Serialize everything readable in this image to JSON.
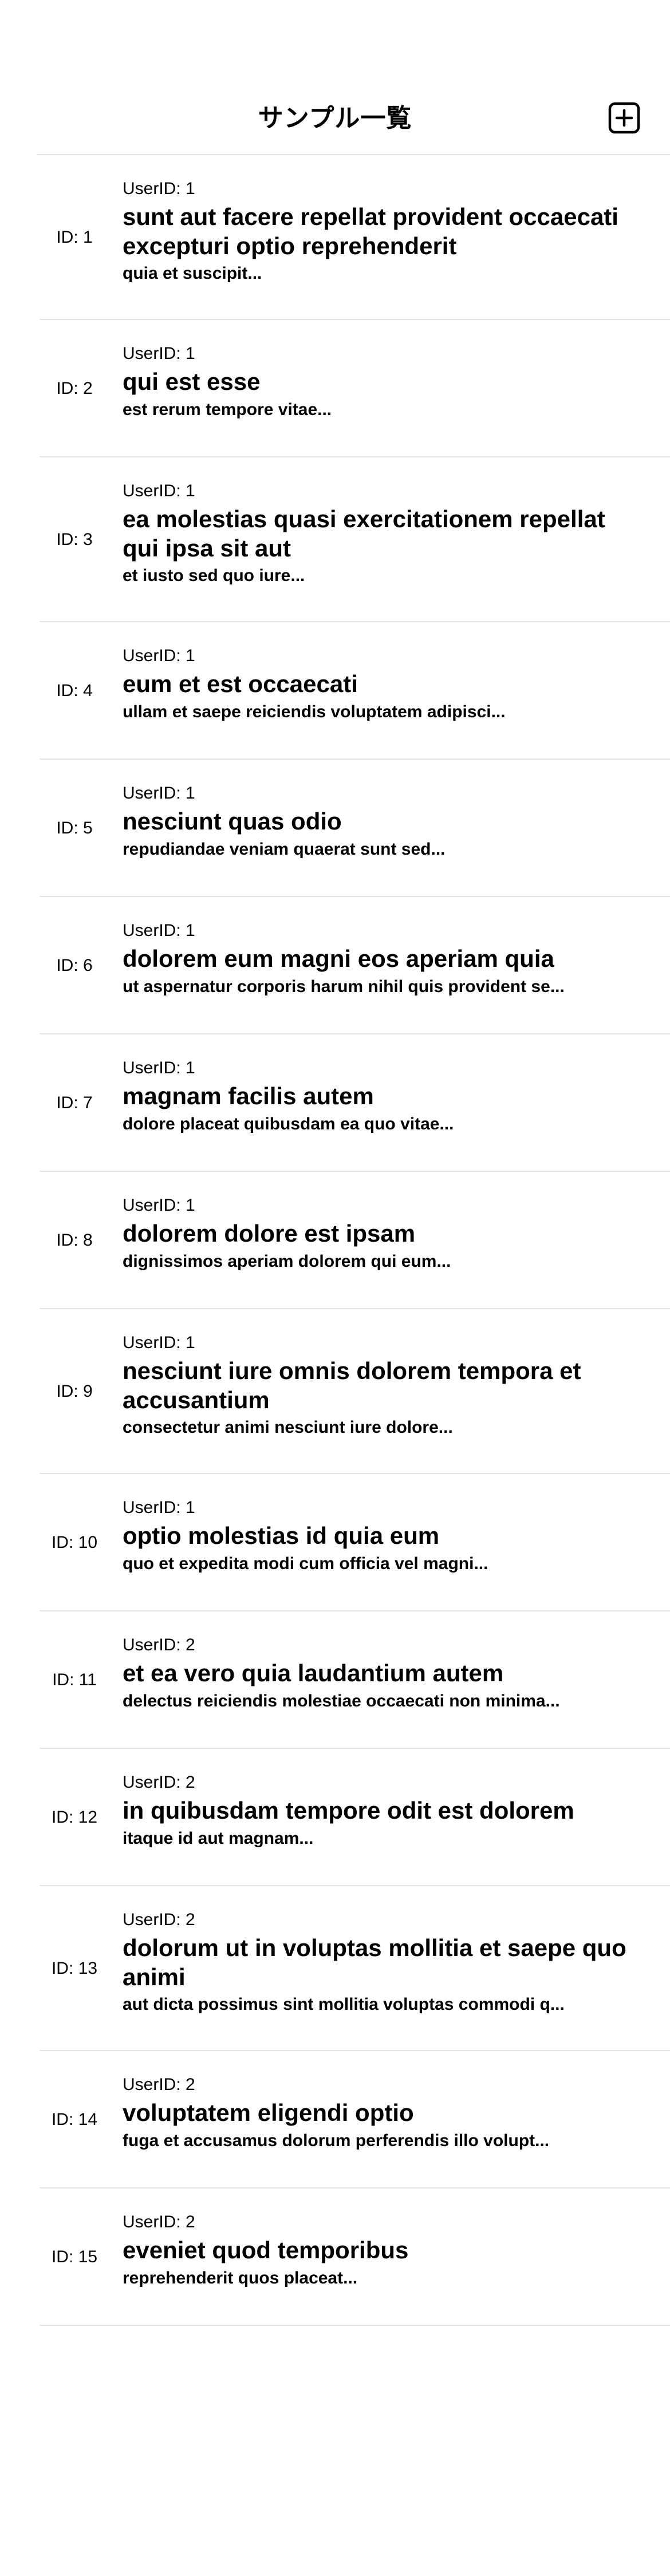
{
  "header": {
    "title": "サンプル一覧",
    "add_icon": "plus-square-icon"
  },
  "posts": [
    {
      "id_label": "ID: 1",
      "user_label": "UserID: 1",
      "title": "sunt aut facere repellat provident occaecati excepturi optio reprehenderit",
      "body": "quia et suscipit..."
    },
    {
      "id_label": "ID: 2",
      "user_label": "UserID: 1",
      "title": "qui est esse",
      "body": "est rerum tempore vitae..."
    },
    {
      "id_label": "ID: 3",
      "user_label": "UserID: 1",
      "title": "ea molestias quasi exercitationem repellat qui ipsa sit aut",
      "body": "et iusto sed quo iure..."
    },
    {
      "id_label": "ID: 4",
      "user_label": "UserID: 1",
      "title": "eum et est occaecati",
      "body": "ullam et saepe reiciendis voluptatem adipisci..."
    },
    {
      "id_label": "ID: 5",
      "user_label": "UserID: 1",
      "title": "nesciunt quas odio",
      "body": "repudiandae veniam quaerat sunt sed..."
    },
    {
      "id_label": "ID: 6",
      "user_label": "UserID: 1",
      "title": "dolorem eum magni eos aperiam quia",
      "body": "ut aspernatur corporis harum nihil quis provident se..."
    },
    {
      "id_label": "ID: 7",
      "user_label": "UserID: 1",
      "title": "magnam facilis autem",
      "body": "dolore placeat quibusdam ea quo vitae..."
    },
    {
      "id_label": "ID: 8",
      "user_label": "UserID: 1",
      "title": "dolorem dolore est ipsam",
      "body": "dignissimos aperiam dolorem qui eum..."
    },
    {
      "id_label": "ID: 9",
      "user_label": "UserID: 1",
      "title": "nesciunt iure omnis dolorem tempora et accusantium",
      "body": "consectetur animi nesciunt iure dolore..."
    },
    {
      "id_label": "ID: 10",
      "user_label": "UserID: 1",
      "title": "optio molestias id quia eum",
      "body": "quo et expedita modi cum officia vel magni..."
    },
    {
      "id_label": "ID: 11",
      "user_label": "UserID: 2",
      "title": "et ea vero quia laudantium autem",
      "body": "delectus reiciendis molestiae occaecati non minima..."
    },
    {
      "id_label": "ID: 12",
      "user_label": "UserID: 2",
      "title": "in quibusdam tempore odit est dolorem",
      "body": "itaque id aut magnam..."
    },
    {
      "id_label": "ID: 13",
      "user_label": "UserID: 2",
      "title": "dolorum ut in voluptas mollitia et saepe quo animi",
      "body": "aut dicta possimus sint mollitia voluptas commodi q..."
    },
    {
      "id_label": "ID: 14",
      "user_label": "UserID: 2",
      "title": "voluptatem eligendi optio",
      "body": "fuga et accusamus dolorum perferendis illo volupt..."
    },
    {
      "id_label": "ID: 15",
      "user_label": "UserID: 2",
      "title": "eveniet quod temporibus",
      "body": "reprehenderit quos placeat..."
    }
  ]
}
